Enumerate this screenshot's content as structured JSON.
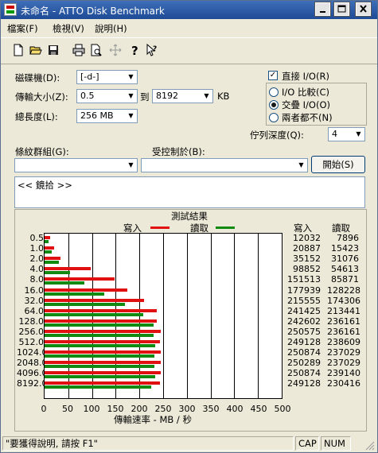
{
  "window": {
    "title": "未命名 - ATTO Disk Benchmark"
  },
  "menu": {
    "file": "檔案(F)",
    "view": "檢視(V)",
    "help": "說明(H)"
  },
  "settings": {
    "drive_label": "磁碟機(D):",
    "drive_value": "[-d-]",
    "transfer_label": "傳輸大小(Z):",
    "transfer_from": "0.5",
    "to_label": "到",
    "transfer_to": "8192",
    "kb_label": "KB",
    "length_label": "總長度(L):",
    "length_value": "256 MB",
    "direct_io_label": "直接 I/O(R)",
    "direct_io_checked": true,
    "radio_compare": "I/O 比較(C)",
    "radio_overlap": "交疊 I/O(O)",
    "radio_neither": "兩者都不(N)",
    "queue_label": "佇列深度(Q):",
    "queue_value": "4",
    "pattern_label": "條紋群組(G):",
    "control_label": "受控制於(B):",
    "start_button": "開始(S)",
    "log_text": "<< 鏡拾 >>"
  },
  "results": {
    "title": "測試結果",
    "legend_write": "寫入",
    "legend_read": "讀取",
    "col_write": "寫入",
    "col_read": "讀取",
    "x_axis_label": "傳輸速率 - MB / 秒"
  },
  "chart_data": {
    "type": "bar",
    "title": "測試結果",
    "xlabel": "傳輸速率 - MB / 秒",
    "xlim": [
      0,
      500
    ],
    "x_ticks": [
      "0",
      "50",
      "100",
      "150",
      "200",
      "250",
      "300",
      "350",
      "400",
      "450",
      "500"
    ],
    "categories": [
      "0.5",
      "1.0",
      "2.0",
      "4.0",
      "8.0",
      "16.0",
      "32.0",
      "64.0",
      "128.0",
      "256.0",
      "512.0",
      "1024.0",
      "2048.0",
      "4096.0",
      "8192.0"
    ],
    "series": [
      {
        "name": "寫入",
        "color": "#e01010",
        "values": [
          12032,
          20887,
          35152,
          98852,
          151513,
          177939,
          215555,
          241425,
          242602,
          250575,
          249128,
          250874,
          250289,
          250874,
          249128
        ]
      },
      {
        "name": "讀取",
        "color": "#108a10",
        "values": [
          7896,
          15423,
          31076,
          54613,
          85871,
          128228,
          174306,
          213441,
          236161,
          236161,
          238609,
          237029,
          237029,
          239140,
          230416
        ]
      }
    ],
    "grid": true,
    "legend": "top"
  },
  "statusbar": {
    "hint": "\"要獲得說明, 請按 F1\"",
    "cap": "CAP",
    "num": "NUM"
  },
  "colors": {
    "titlebar": "#2a5aa8",
    "write": "#e01010",
    "read": "#108a10",
    "face": "#ece9d8"
  },
  "icons": [
    "new-file-icon",
    "open-folder-icon",
    "save-icon",
    "print-icon",
    "print-preview-icon",
    "move-icon",
    "help-icon",
    "context-help-icon"
  ]
}
